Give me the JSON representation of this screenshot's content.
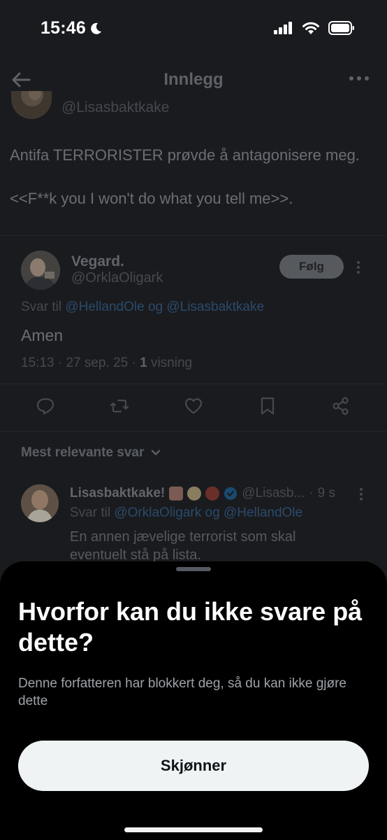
{
  "status_bar": {
    "time": "15:46"
  },
  "header": {
    "title": "Innlegg"
  },
  "main_post": {
    "author_handle": "@Lisasbaktkake",
    "text_line_1": "Antifa TERRORISTER prøvde å antagonisere meg.",
    "text_line_2": "<<F**k you I won't do what you tell me>>."
  },
  "reply_post": {
    "author_name": "Vegard.",
    "author_handle": "@OrklaOligark",
    "follow_label": "Følg",
    "reply_to_prefix": "Svar til",
    "reply_to_user_1": "@HellandOle",
    "reply_to_joiner": "og",
    "reply_to_user_2": "@Lisasbaktkake",
    "text": "Amen",
    "time": "15:13",
    "date": "27 sep. 25",
    "views_count": "1",
    "views_label": "visning"
  },
  "sort": {
    "label": "Mest relevante svar"
  },
  "comment": {
    "author_name": "Lisasbaktkake!",
    "author_handle": "@Lisasb...",
    "age": "9 s",
    "reply_to_prefix": "Svar til",
    "reply_to_user_1": "@OrklaOligark",
    "reply_to_joiner": "og",
    "reply_to_user_2": "@HellandOle",
    "text": "En annen jævelige terrorist som skal eventuelt stå på lista."
  },
  "sheet": {
    "title": "Hvorfor kan du ikke svare på dette?",
    "body": "Denne forfatteren har blokkert deg, så du kan ikke gjøre dette",
    "button_label": "Skjønner"
  },
  "colors": {
    "sheet_background": "#000000",
    "button_background": "#eff3f4",
    "link_dimmed": "#2a4a6c",
    "verified_badge": "#1d9bf0"
  }
}
